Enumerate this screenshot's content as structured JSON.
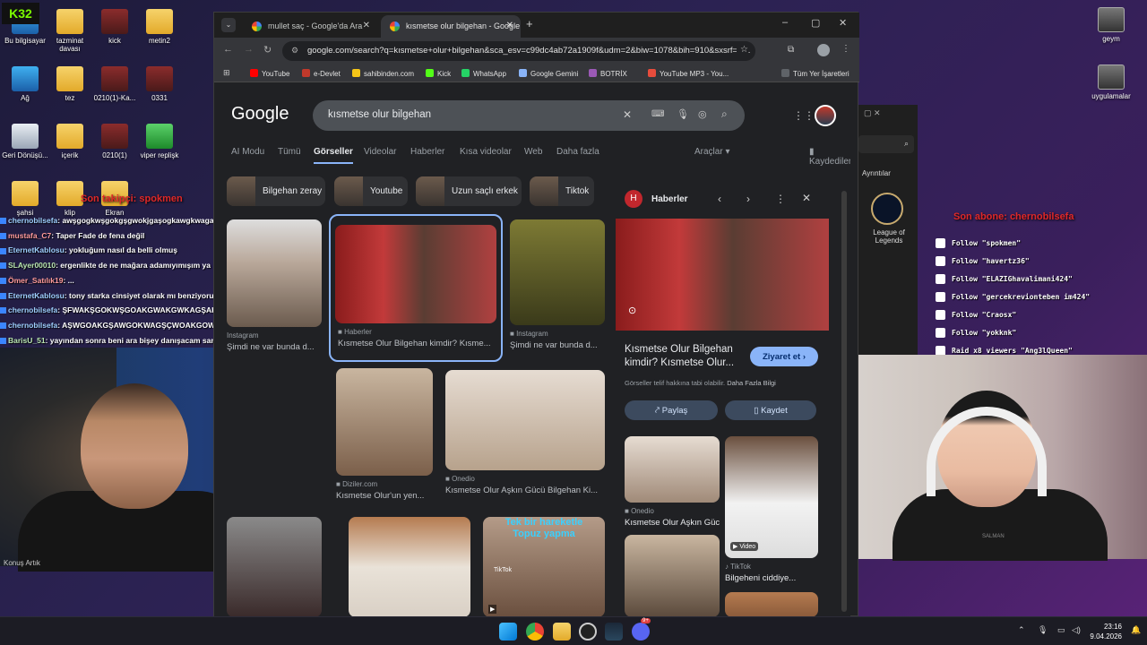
{
  "desktop": {
    "icons": [
      {
        "label": "Bu bilgisayar"
      },
      {
        "label": "tazminat davası"
      },
      {
        "label": "kick"
      },
      {
        "label": "metin2"
      },
      {
        "label": "Ağ"
      },
      {
        "label": "tez"
      },
      {
        "label": "0210(1)-Ka..."
      },
      {
        "label": "0331"
      },
      {
        "label": "Geri Dönüşü..."
      },
      {
        "label": "içerik"
      },
      {
        "label": "0210(1)"
      },
      {
        "label": "viper replişk"
      },
      {
        "label": "şahsi"
      },
      {
        "label": "klip"
      },
      {
        "label": "Ekran"
      }
    ],
    "right_icons": [
      {
        "label": "geym"
      },
      {
        "label": "uygulamalar"
      }
    ],
    "lol_icon": "League of Legends",
    "ayrintilar": "Ayrıntılar",
    "k32_logo": "K32"
  },
  "stream": {
    "last_follow_title": "Son takipçi: spokmen",
    "last_sub_title": "Son abone: chernobilsefa",
    "chat": [
      {
        "user": "chernobilsefa",
        "text": ": awşgogkwşgokgşgwokjgaşogkawgkwaga",
        "cls": "u1"
      },
      {
        "user": "mustafa_C7",
        "text": ": Taper Fade de fena değil",
        "cls": "u2"
      },
      {
        "user": "EternetKablosu",
        "text": ": yokluğum nasıl da belli olmuş",
        "cls": "u1"
      },
      {
        "user": "SLAyer00010",
        "text": ": ergenlikte de ne mağara adamıyımışım ya",
        "cls": "u3"
      },
      {
        "user": "Ömer_Satılık19",
        "text": ": ...",
        "cls": "u2"
      },
      {
        "user": "EternetKablosu",
        "text": ": tony starka cinsiyet olarak mı benziyoruz",
        "cls": "u1"
      },
      {
        "user": "chernobilsefa",
        "text": ": ŞFWAKŞGOKWŞGOAKGWAKGWKAGŞAKOGKA",
        "cls": "u1"
      },
      {
        "user": "chernobilsefa",
        "text": ": AŞWGOAKGŞAWGOKWAGŞÇWOAKGOWŞAK",
        "cls": "u1"
      },
      {
        "user": "BarisU_51",
        "text": ": yayından sonra beni ara bişey danışacam sana abi konuşmamız gerekiyor",
        "cls": "u3"
      }
    ],
    "cam1_caption": "Konuş Artık",
    "follows": [
      "Follow \"spokmen\"",
      "Follow \"havertz36\"",
      "Follow \"ELAZIGhavalimani424\"",
      "Follow \"gercekrevionteben im424\"",
      "Follow \"Craosx\"",
      "Follow \"yokknk\"",
      "Raid x8 viewers \"Ang3lQueen\""
    ],
    "cam2_text": "SALMAN"
  },
  "browser": {
    "tabs": [
      {
        "label": "mullet saç - Google'da Ara"
      },
      {
        "label": "kısmetse olur bilgehan - Google"
      }
    ],
    "url": "google.com/search?q=kısmetse+olur+bilgehan&sca_esv=c99dc4ab72a1909f&udm=2&biw=1078&bih=910&sxsrf=A...",
    "bookmarks": [
      "YouTube",
      "e-Devlet",
      "sahibinden.com",
      "Kick",
      "WhatsApp",
      "Google Gemini",
      "BOTRİX",
      "YouTube MP3 - You...",
      "Tüm Yer İşaretleri"
    ],
    "bookmark_colors": [
      "#ff0000",
      "#c0392b",
      "#f5c518",
      "#53fc18",
      "#25d366",
      "#8ab4f8",
      "#9b59b6",
      "#e74c3c",
      "#5f6368"
    ],
    "search_query": "kısmetse olur bilgehan",
    "nav_tabs": [
      "AI Modu",
      "Tümü",
      "Görseller",
      "Videolar",
      "Haberler",
      "Kısa videolar",
      "Web",
      "Daha fazla"
    ],
    "tools": "Araçlar",
    "saved": "Kaydedilenler",
    "chips": [
      "Bilgehan zeray",
      "Youtube",
      "Uzun saçlı erkek",
      "Tiktok"
    ],
    "results": [
      {
        "src": "Instagram",
        "title": "Şimdi ne var bunda d..."
      },
      {
        "src": "Haberler",
        "title": "Kısmetse Olur Bilgehan kimdir? Kısme..."
      },
      {
        "src": "Instagram",
        "title": "Şimdi ne var bunda d..."
      },
      {
        "src": "Diziler.com",
        "title": "Kısmetse Olur'un yen..."
      },
      {
        "src": "Onedio",
        "title": "Kısmetse Olur Aşkın Gücü Bilgehan Ki..."
      }
    ],
    "tiktok_overlay": "Tek bir hareketle Topuz yapma",
    "tiktok_label": "TikTok",
    "panel": {
      "source": "Haberler",
      "title": "Kısmetse Olur Bilgehan kimdir? Kısmetse Olur...",
      "visit": "Ziyaret et",
      "copyright": "Görseller telif hakkına tabi olabilir.",
      "more_info": "Daha Fazla Bilgi",
      "share": "Paylaş",
      "save": "Kaydet",
      "related": [
        {
          "src": "Onedio",
          "title": "Kısmetse Olur Aşkın Güc..."
        },
        {
          "src": "TikTok",
          "title": "Bilgeheni ciddiye...",
          "badge": "Video"
        }
      ]
    }
  },
  "taskbar": {
    "time": "23:16",
    "date": "9.04.2026",
    "discord_badge": "9+"
  }
}
